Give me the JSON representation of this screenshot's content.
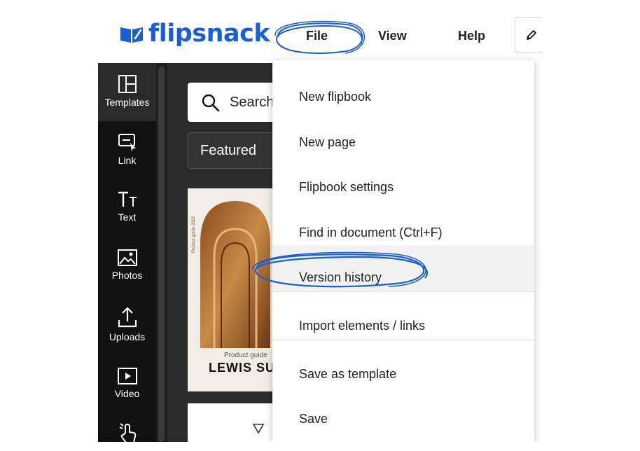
{
  "app": {
    "logo_text": "flipsnack",
    "brand_color": "#1a5fd6",
    "annotation_color": "#1a5fd6"
  },
  "menubar": {
    "file_label": "File",
    "view_label": "View",
    "help_label": "Help",
    "edit_icon": "pencil-icon"
  },
  "sidebar": {
    "items": [
      {
        "label": "Templates",
        "icon": "templates-icon",
        "active": true
      },
      {
        "label": "Link",
        "icon": "link-icon"
      },
      {
        "label": "Text",
        "icon": "text-icon"
      },
      {
        "label": "Photos",
        "icon": "photos-icon"
      },
      {
        "label": "Uploads",
        "icon": "uploads-icon"
      },
      {
        "label": "Video",
        "icon": "video-icon"
      },
      {
        "label": "",
        "icon": "interaction-icon"
      }
    ]
  },
  "panel": {
    "search_text": "Search",
    "featured_label": "Featured",
    "template1": {
      "vertical_text": "Product guide 2022",
      "subtitle": "Product guide",
      "title": "LEWIS SUP"
    }
  },
  "dropdown": {
    "items": [
      {
        "label": "New flipbook"
      },
      {
        "label": "New page"
      },
      {
        "label": "Flipbook settings"
      },
      {
        "label": "Find in document (Ctrl+F)"
      },
      {
        "label": "Version history",
        "highlighted": true
      },
      {
        "label": "Import elements / links"
      },
      {
        "label": "Save as template"
      },
      {
        "label": "Save"
      }
    ]
  }
}
